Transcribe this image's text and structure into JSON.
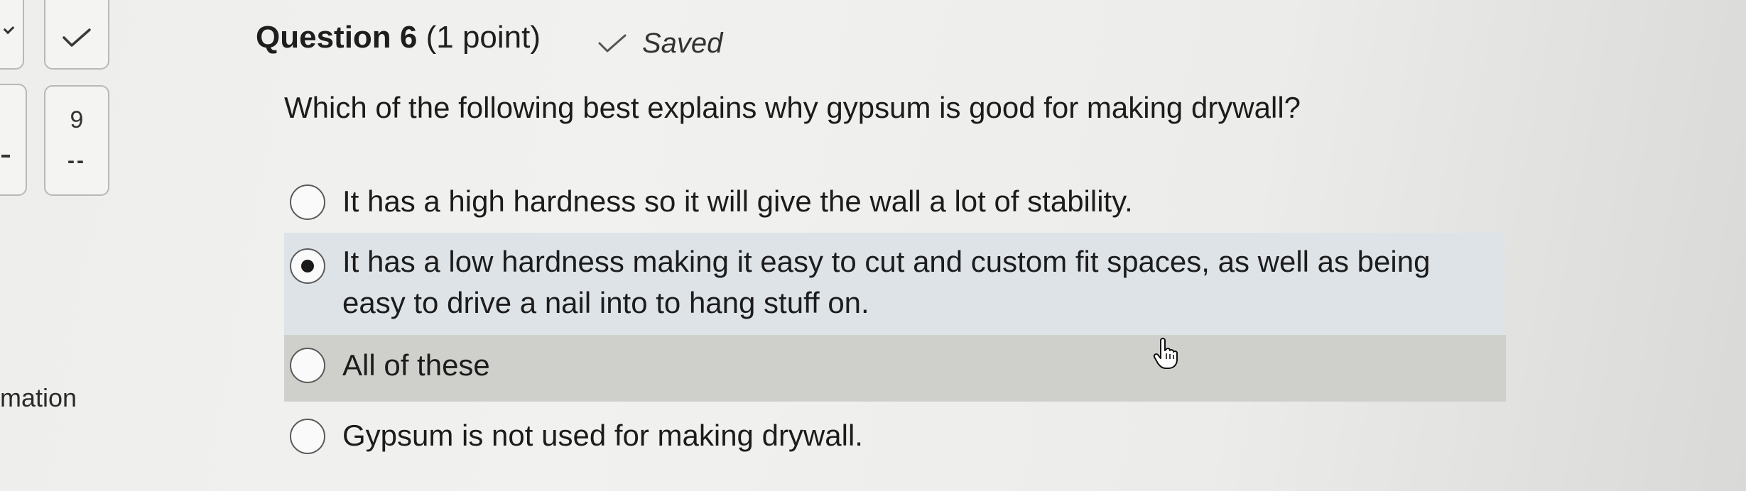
{
  "nav": {
    "question_number": "9",
    "unanswered_marker": "--",
    "icons": {
      "answered": "checkmark-icon"
    }
  },
  "left_fragment": "mation",
  "question": {
    "title": "Question 6",
    "points": "(1 point)",
    "saved_status": "Saved",
    "text": "Which of the following best explains why gypsum is good for making drywall?"
  },
  "options": [
    {
      "label": "It has a high hardness so it will give the wall a lot of stability.",
      "selected": false
    },
    {
      "label": "It has a low hardness making it easy to cut and custom fit spaces, as well as being easy to drive a nail into to hang stuff on.",
      "selected": true
    },
    {
      "label": "All of these",
      "selected": false
    },
    {
      "label": "Gypsum is not used for making drywall.",
      "selected": false
    }
  ],
  "colors": {
    "selected_row_bg": "#dde3e6",
    "hover_row_bg": "#cfcfcc",
    "page_bg": "#efefed",
    "text": "#1c1c1c"
  },
  "cursor": "hand-pointer-icon"
}
